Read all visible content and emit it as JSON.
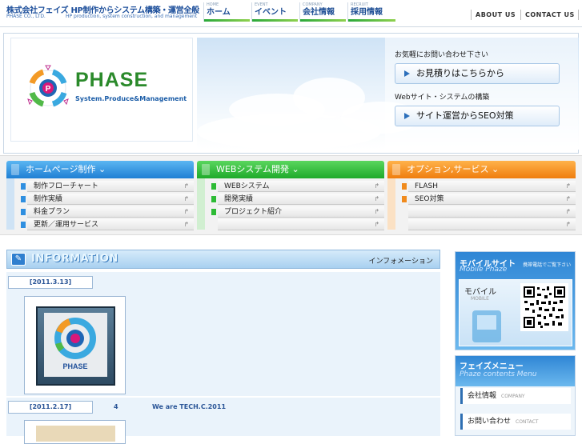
{
  "header": {
    "company_name": "株式会社フェイズ HP制作からシステム構築・運営全般",
    "company_en": "PHASE CO., LTD.",
    "tagline_en": "HP production, system construction, and management",
    "global_nav": [
      {
        "en": "HOME",
        "jp": "ホーム"
      },
      {
        "en": "EVENT",
        "jp": "イベント"
      },
      {
        "en": "COMPANY",
        "jp": "会社情報"
      },
      {
        "en": "RECRUIT",
        "jp": "採用情報"
      }
    ],
    "about_us": "ABOUT US",
    "contact_us": "CONTACT US"
  },
  "hero": {
    "logo_text": "PHASE",
    "logo_sub": "System.Produce&Management",
    "logo_letter": "P",
    "inquiry_label": "お気軽にお問い合わせ下さい",
    "estimate_button": "お見積りはこちらから",
    "web_label": "Webサイト・システムの構築",
    "seo_button": "サイト運営からSEO対策"
  },
  "menus": [
    {
      "title": "ホームページ制作",
      "items": [
        "制作フローチャート",
        "制作実績",
        "料金プラン",
        "更新／運用サービス"
      ],
      "color": "#2f8fe0"
    },
    {
      "title": "WEBシステム開発",
      "items": [
        "WEBシステム",
        "開発実績",
        "プロジェクト紹介"
      ],
      "color": "#2dbb35"
    },
    {
      "title": "オプション,サービス",
      "items": [
        "FLASH",
        "SEO対策"
      ],
      "color": "#f08a1c"
    }
  ],
  "information": {
    "title": "INFORMATION",
    "title_jp": "インフォメーション",
    "entries": [
      {
        "date": "[2011.3.13]",
        "num": "",
        "text": ""
      },
      {
        "date": "[2011.2.17]",
        "num": "4",
        "text": "We are TECH.C.2011"
      }
    ],
    "thumb_sign": "PHASE"
  },
  "sidebar": {
    "mobile_title": "モバイルサイト",
    "mobile_note": "携帯電話でご覧下さい",
    "mobile_sub": "Mobile Phaze",
    "mobile_label": "モバイル",
    "mobile_label_en": "MOBILE",
    "menu_title": "フェイズメニュー",
    "menu_sub": "Phaze contents Menu",
    "menu_items": [
      {
        "jp": "会社情報",
        "en": "COMPANY"
      },
      {
        "jp": "お問い合わせ",
        "en": "CONTACT"
      }
    ]
  },
  "colors": {
    "brand_blue": "#1d4f9b",
    "brand_green": "#2aa83a",
    "accent_orange": "#f08a1c"
  }
}
